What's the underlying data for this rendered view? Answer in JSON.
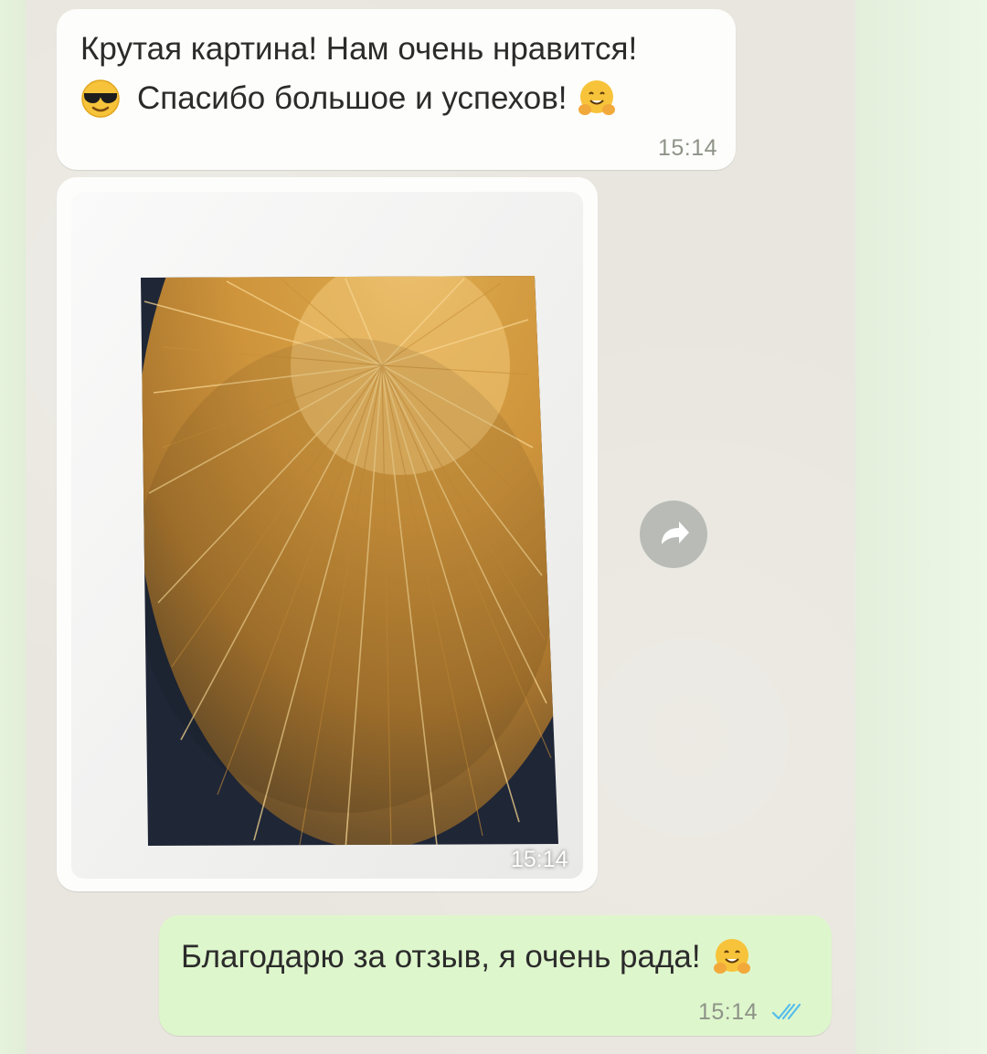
{
  "messages": [
    {
      "direction": "incoming",
      "line1": "Крутая картина! Нам очень нравится!",
      "line2": "Спасибо большое и успехов!",
      "leading_emoji": "sunglasses-face-emoji",
      "trailing_emoji": "hugging-face-emoji",
      "time": "15:14"
    },
    {
      "direction": "incoming",
      "type": "photo",
      "photo_subject": "painting-golden-rays-on-dark-background",
      "time": "15:14"
    },
    {
      "direction": "outgoing",
      "text": "Благодарю за отзыв, я очень рада!",
      "trailing_emoji": "hugging-face-emoji",
      "time": "15:14",
      "status": "read"
    }
  ],
  "actions": {
    "forward_icon": "forward-arrow-icon"
  },
  "colors": {
    "incoming_bubble": "#fdfdfb",
    "outgoing_bubble": "#def6cc",
    "chat_background": "#e9e6df",
    "read_ticks": "#53bdeb"
  }
}
